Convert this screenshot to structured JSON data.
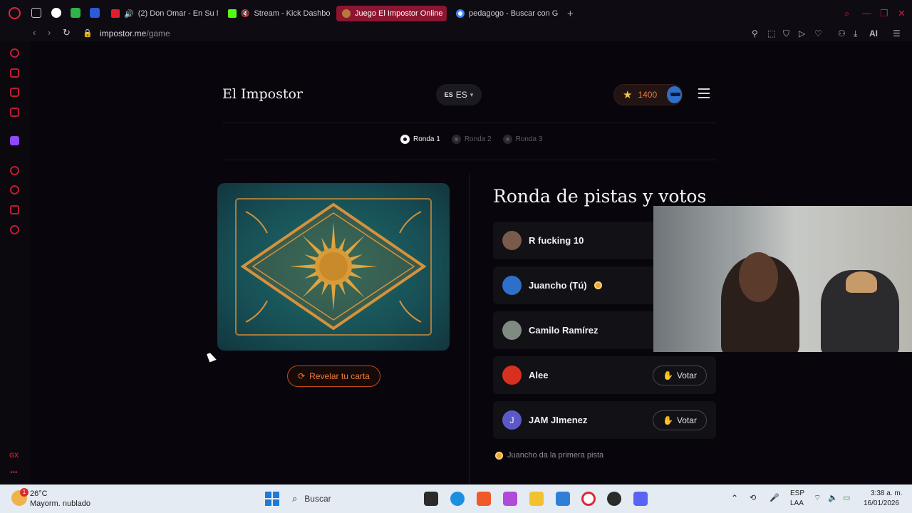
{
  "browser": {
    "tabs": [
      {
        "label": "(2) Don Omar - En Su M",
        "favicon_color": "#e31c2b",
        "muted": false
      },
      {
        "label": "Stream - Kick Dashbo",
        "favicon_color": "#53fc18",
        "muted": true
      },
      {
        "label": "Juego El Impostor Online",
        "favicon_color": "#b87a3a",
        "active": true
      },
      {
        "label": "pedagogo - Buscar con G",
        "favicon_color": "#4285f4"
      }
    ],
    "new_tab_label": "+",
    "url_domain": "impostor.me",
    "url_path": "/game",
    "ai_label": "AI"
  },
  "app": {
    "title": "El Impostor",
    "language": {
      "flag": "ES",
      "code": "ES"
    },
    "coins": "1400",
    "rounds": [
      {
        "label": "Ronda 1",
        "active": true
      },
      {
        "label": "Ronda 2",
        "active": false
      },
      {
        "label": "Ronda 3",
        "active": false
      }
    ],
    "reveal_button": "Revelar tu carta",
    "section_title": "Ronda de pistas y votos",
    "players": [
      {
        "name": "R fucking 10",
        "avatar_color": "#7a5a4a",
        "avatar": "robot-red",
        "vote": false
      },
      {
        "name": "Juancho (Tú)",
        "avatar_color": "#2e6fc9",
        "avatar": "robot-blue",
        "vote": false,
        "first_clue": true
      },
      {
        "name": "Camilo Ramírez",
        "avatar_color": "#7f8a80",
        "avatar": "photo",
        "vote": false
      },
      {
        "name": "Alee",
        "avatar_color": "#d8301f",
        "avatar": "robot-red",
        "vote": true
      },
      {
        "name": "JAM JImenez",
        "avatar_color": "#5b59c8",
        "avatar": "letter",
        "initial": "J",
        "vote": true
      }
    ],
    "vote_label": "Votar",
    "hint_text": "Juancho da la primera pista"
  },
  "taskbar": {
    "weather_temp": "26°C",
    "weather_desc": "Mayorm. nublado",
    "weather_badge": "1",
    "search_label": "Buscar",
    "lang_line1": "ESP",
    "lang_line2": "LAA",
    "time": "3:38 a. m.",
    "date": "16/01/2026"
  }
}
